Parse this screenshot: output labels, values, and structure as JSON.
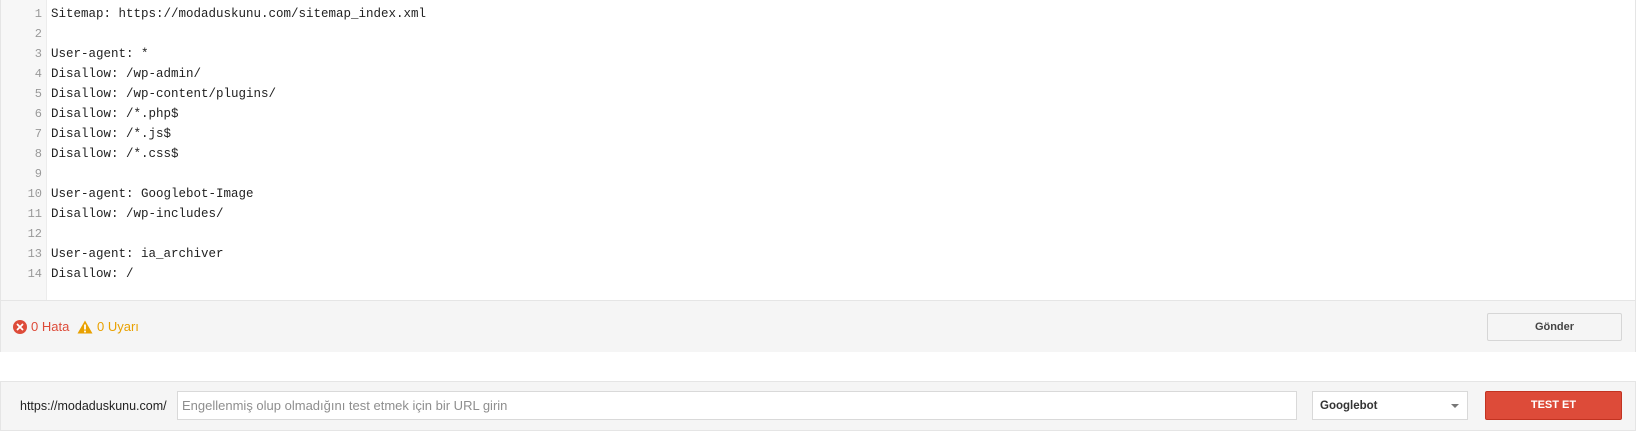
{
  "editor": {
    "lines": [
      {
        "num": "1",
        "text": "Sitemap: https://modaduskunu.com/sitemap_index.xml"
      },
      {
        "num": "2",
        "text": ""
      },
      {
        "num": "3",
        "text": "User-agent: *"
      },
      {
        "num": "4",
        "text": "Disallow: /wp-admin/"
      },
      {
        "num": "5",
        "text": "Disallow: /wp-content/plugins/"
      },
      {
        "num": "6",
        "text": "Disallow: /*.php$"
      },
      {
        "num": "7",
        "text": "Disallow: /*.js$"
      },
      {
        "num": "8",
        "text": "Disallow: /*.css$"
      },
      {
        "num": "9",
        "text": ""
      },
      {
        "num": "10",
        "text": "User-agent: Googlebot-Image"
      },
      {
        "num": "11",
        "text": "Disallow: /wp-includes/"
      },
      {
        "num": "12",
        "text": ""
      },
      {
        "num": "13",
        "text": "User-agent: ia_archiver"
      },
      {
        "num": "14",
        "text": "Disallow: /"
      }
    ]
  },
  "status": {
    "errors_label": "0 Hata",
    "warnings_label": "0 Uyarı",
    "error_icon": "error-circle-icon",
    "warning_icon": "warning-triangle-icon",
    "error_color": "#dd4b39",
    "warning_color": "#e9a100"
  },
  "submit_button": {
    "label": "Gönder"
  },
  "tester": {
    "url_prefix": "https://modaduskunu.com/",
    "url_input_value": "",
    "url_input_placeholder": "Engellenmiş olup olmadığını test etmek için bir URL girin",
    "bot_selected": "Googlebot",
    "test_button_label": "TEST ET",
    "test_button_color": "#dd4b39"
  }
}
